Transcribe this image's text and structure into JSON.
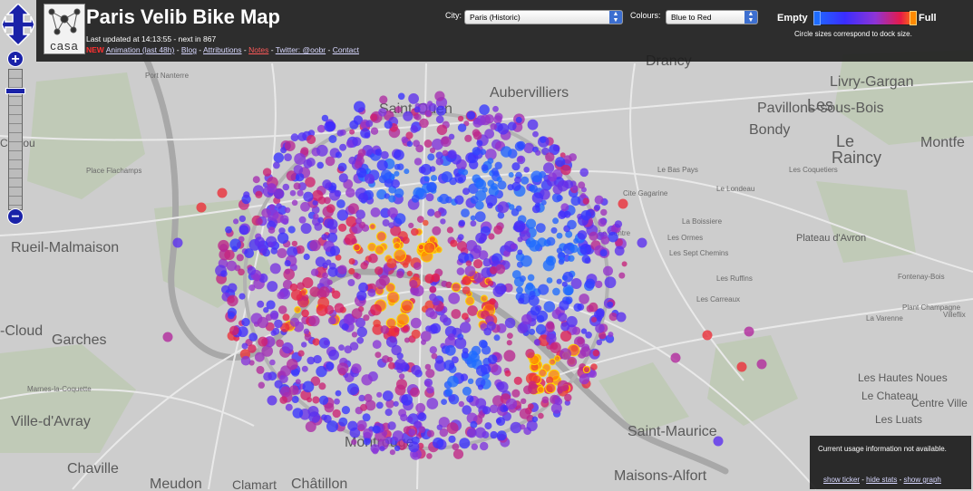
{
  "header": {
    "title": "Paris Velib Bike Map",
    "updated": "Last updated at 14:13:55 - next in 867",
    "logo_text": "casa",
    "links": {
      "new_badge": "NEW",
      "animation": "Animation (last 48h)",
      "blog": "Blog",
      "attributions": "Attributions",
      "notes": "Notes",
      "twitter": "Twitter: @oobr",
      "contact": "Contact"
    },
    "city_label": "City:",
    "city_value": "Paris (Historic)",
    "colours_label": "Colours:",
    "colours_value": "Blue to Red",
    "legend": {
      "empty": "Empty",
      "full": "Full",
      "note": "Circle sizes correspond to dock size."
    }
  },
  "stats": {
    "message": "Current usage information not available.",
    "show_ticker": "show ticker",
    "hide_stats": "hide stats",
    "show_graph": "show graph"
  },
  "map_labels": [
    {
      "text": "Saint-Ouen",
      "size": 16
    },
    {
      "text": "Aubervilliers",
      "size": 16
    },
    {
      "text": "Drancy",
      "size": 16
    },
    {
      "text": "Livry-Gargan",
      "size": 16
    },
    {
      "text": "Les",
      "size": 18
    },
    {
      "text": "Pavillons-sous-Bois",
      "size": 16
    },
    {
      "text": "Bondy",
      "size": 16
    },
    {
      "text": "Le",
      "size": 18
    },
    {
      "text": "Raincy",
      "size": 18
    },
    {
      "text": "Montfe",
      "size": 16
    },
    {
      "text": "Rueil-Malmaison",
      "size": 16
    },
    {
      "text": "Plateau d'Avron",
      "size": 11
    },
    {
      "text": "-Cloud",
      "size": 16
    },
    {
      "text": "Garches",
      "size": 16
    },
    {
      "text": "Ville-d'Avray",
      "size": 16
    },
    {
      "text": "Chaville",
      "size": 16
    },
    {
      "text": "Meudon",
      "size": 16
    },
    {
      "text": "Clamart",
      "size": 14
    },
    {
      "text": "Châtillon",
      "size": 16
    },
    {
      "text": "Montrouge",
      "size": 16
    },
    {
      "text": "Saint-Maurice",
      "size": 16
    },
    {
      "text": "Maisons-Alfort",
      "size": 16
    },
    {
      "text": "Les Hautes Noues",
      "size": 12
    },
    {
      "text": "Le Chateau",
      "size": 12
    },
    {
      "text": "Centre Ville",
      "size": 12
    },
    {
      "text": "Les Luats",
      "size": 12
    },
    {
      "text": "Chatou",
      "size": 12
    },
    {
      "text": "Place Flachamps",
      "size": 8
    },
    {
      "text": "Port Nanterre",
      "size": 8
    },
    {
      "text": "Cite Gagarine",
      "size": 8
    },
    {
      "text": "La Boissiere",
      "size": 8
    },
    {
      "text": "Les Sept Chemins",
      "size": 8
    },
    {
      "text": "Les Ormes",
      "size": 8
    },
    {
      "text": "Les Ruffins",
      "size": 8
    },
    {
      "text": "Le Londeau",
      "size": 8
    },
    {
      "text": "Les Carreaux",
      "size": 8
    },
    {
      "text": "Villeflix",
      "size": 8
    },
    {
      "text": "Marnes-la-Coquette",
      "size": 8
    },
    {
      "text": "Le Bas Pays",
      "size": 8
    },
    {
      "text": "Les Coquetiers",
      "size": 8
    },
    {
      "text": "La Varenne",
      "size": 8
    },
    {
      "text": "Plant Champagne",
      "size": 8
    },
    {
      "text": "Fontenay-Bois",
      "size": 8
    },
    {
      "text": "Le Centre",
      "size": 8
    }
  ],
  "colors": {
    "empty": "#1e6cff",
    "mid": "#8d34d6",
    "full": "#ff8a00",
    "header_bg": "#1c1c1c",
    "accent": "#1a22a8"
  }
}
